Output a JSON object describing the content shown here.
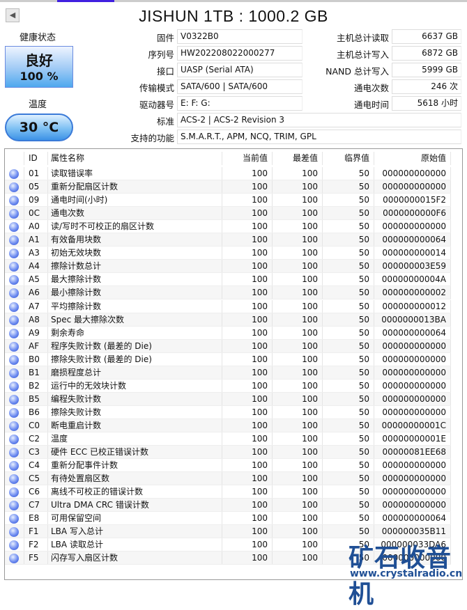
{
  "title": "JISHUN 1TB : 1000.2 GB",
  "health": {
    "label": "健康状态",
    "status": "良好",
    "percent": "100 %"
  },
  "temperature": {
    "label": "温度",
    "value": "30 °C"
  },
  "info_left": [
    {
      "label": "固件",
      "value": "V0322B0"
    },
    {
      "label": "序列号",
      "value": "HW202208022000277"
    },
    {
      "label": "接口",
      "value": "UASP (Serial ATA)"
    },
    {
      "label": "传输模式",
      "value": "SATA/600 | SATA/600"
    },
    {
      "label": "驱动器号",
      "value": "E: F: G:"
    }
  ],
  "info_right": [
    {
      "label": "主机总计读取",
      "value": "6637 GB"
    },
    {
      "label": "主机总计写入",
      "value": "6872 GB"
    },
    {
      "label": "NAND 总计写入",
      "value": "5999 GB"
    },
    {
      "label": "通电次数",
      "value": "246 次"
    },
    {
      "label": "通电时间",
      "value": "5618 小时"
    }
  ],
  "standard": {
    "label": "标准",
    "value": "ACS-2 | ACS-2 Revision 3"
  },
  "features": {
    "label": "支持的功能",
    "value": "S.M.A.R.T., APM, NCQ, TRIM, GPL"
  },
  "columns": [
    "ID",
    "属性名称",
    "当前值",
    "最差值",
    "临界值",
    "原始值"
  ],
  "rows": [
    [
      "01",
      "读取错误率",
      "100",
      "100",
      "50",
      "000000000000"
    ],
    [
      "05",
      "重新分配扇区计数",
      "100",
      "100",
      "50",
      "000000000000"
    ],
    [
      "09",
      "通电时间(小时)",
      "100",
      "100",
      "50",
      "0000000015F2"
    ],
    [
      "0C",
      "通电次数",
      "100",
      "100",
      "50",
      "0000000000F6"
    ],
    [
      "A0",
      "读/写时不可校正的扇区计数",
      "100",
      "100",
      "50",
      "000000000000"
    ],
    [
      "A1",
      "有效备用块数",
      "100",
      "100",
      "50",
      "000000000064"
    ],
    [
      "A3",
      "初始无效块数",
      "100",
      "100",
      "50",
      "000000000014"
    ],
    [
      "A4",
      "擦除计数总计",
      "100",
      "100",
      "50",
      "000000003E59"
    ],
    [
      "A5",
      "最大擦除计数",
      "100",
      "100",
      "50",
      "00000000004A"
    ],
    [
      "A6",
      "最小擦除计数",
      "100",
      "100",
      "50",
      "000000000002"
    ],
    [
      "A7",
      "平均擦除计数",
      "100",
      "100",
      "50",
      "000000000012"
    ],
    [
      "A8",
      "Spec 最大擦除次数",
      "100",
      "100",
      "50",
      "0000000013BA"
    ],
    [
      "A9",
      "剩余寿命",
      "100",
      "100",
      "50",
      "000000000064"
    ],
    [
      "AF",
      "程序失败计数 (最差的 Die)",
      "100",
      "100",
      "50",
      "000000000000"
    ],
    [
      "B0",
      "擦除失败计数 (最差的 Die)",
      "100",
      "100",
      "50",
      "000000000000"
    ],
    [
      "B1",
      "磨损程度总计",
      "100",
      "100",
      "50",
      "000000000000"
    ],
    [
      "B2",
      "运行中的无效块计数",
      "100",
      "100",
      "50",
      "000000000000"
    ],
    [
      "B5",
      "编程失败计数",
      "100",
      "100",
      "50",
      "000000000000"
    ],
    [
      "B6",
      "擦除失败计数",
      "100",
      "100",
      "50",
      "000000000000"
    ],
    [
      "C0",
      "断电重启计数",
      "100",
      "100",
      "50",
      "00000000001C"
    ],
    [
      "C2",
      "温度",
      "100",
      "100",
      "50",
      "00000000001E"
    ],
    [
      "C3",
      "硬件 ECC 已校正错误计数",
      "100",
      "100",
      "50",
      "00000081EE68"
    ],
    [
      "C4",
      "重新分配事件计数",
      "100",
      "100",
      "50",
      "000000000000"
    ],
    [
      "C5",
      "有待处置扇区数",
      "100",
      "100",
      "50",
      "000000000000"
    ],
    [
      "C6",
      "离线不可校正的错误计数",
      "100",
      "100",
      "50",
      "000000000000"
    ],
    [
      "C7",
      "Ultra DMA CRC 错误计数",
      "100",
      "100",
      "50",
      "000000000000"
    ],
    [
      "E8",
      "可用保留空间",
      "100",
      "100",
      "50",
      "000000000064"
    ],
    [
      "F1",
      "LBA 写入总计",
      "100",
      "100",
      "50",
      "000000035B11"
    ],
    [
      "F2",
      "LBA 读取总计",
      "100",
      "100",
      "50",
      "000000033DA6"
    ],
    [
      "F5",
      "闪存写入扇区计数",
      "100",
      "100",
      "50",
      "000000000000"
    ]
  ],
  "watermark": {
    "name": "矿石收音机",
    "url": "www.crystalradio.cn"
  }
}
